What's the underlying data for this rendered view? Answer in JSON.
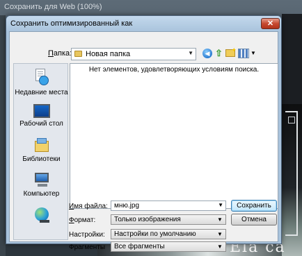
{
  "background": {
    "window_title": "Сохранить для Web (100%)",
    "photo_text": "Ela ca"
  },
  "dialog": {
    "title": "Сохранить оптимизированный как",
    "close_glyph": "✕",
    "folder": {
      "label_accel": "П",
      "label_rest": "апка:",
      "value": "Новая папка"
    },
    "places": [
      {
        "label": "Недавние места",
        "icon": "recent-places-icon"
      },
      {
        "label": "Рабочий стол",
        "icon": "desktop-icon"
      },
      {
        "label": "Библиотеки",
        "icon": "libraries-icon"
      },
      {
        "label": "Компьютер",
        "icon": "computer-icon"
      },
      {
        "label": "",
        "icon": "network-icon"
      }
    ],
    "empty_message": "Нет элементов, удовлетворяющих условиям поиска.",
    "filename": {
      "label_accel": "И",
      "label_rest": "мя файла:",
      "value": "мню.jpg"
    },
    "format": {
      "label_accel": "Ф",
      "label_rest": "ормат:",
      "value": "Только изображения"
    },
    "settings": {
      "label": "Настройки:",
      "value": "Настройки по умолчанию"
    },
    "fragments": {
      "label": "Фрагменты",
      "value": "Все фрагменты"
    },
    "save_button": "Сохранить",
    "cancel_button": "Отмена"
  },
  "colors": {
    "titlebar": "#aac4dd",
    "close_button": "#c74a31",
    "primary_button_border": "#3c7fb1"
  }
}
